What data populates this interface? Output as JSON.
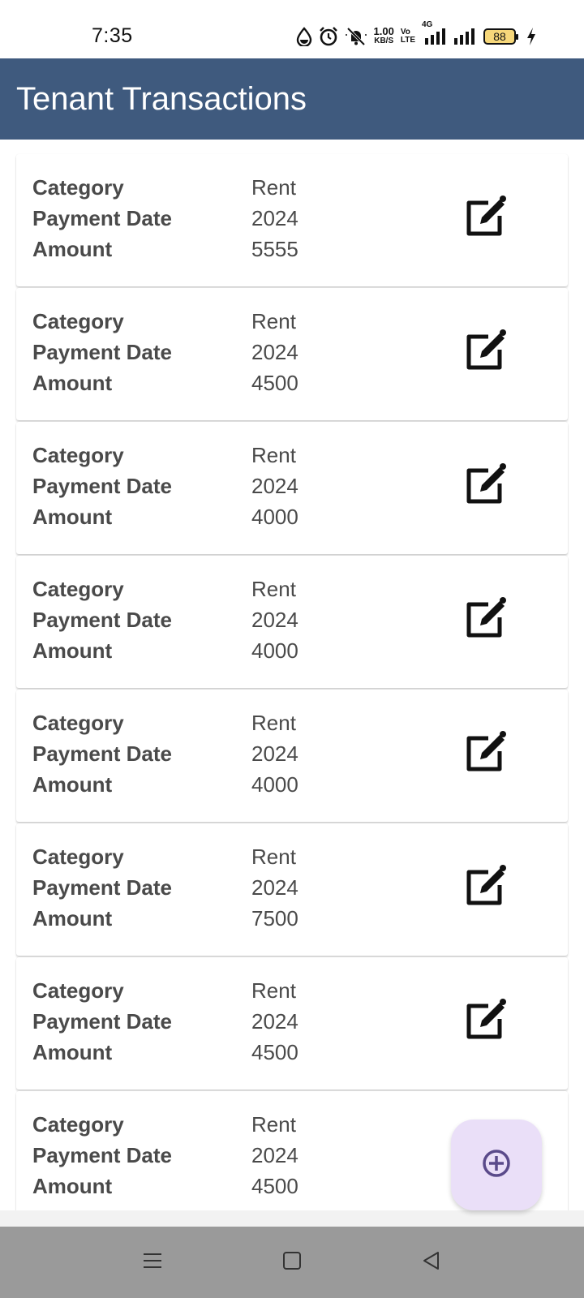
{
  "status_bar": {
    "time": "7:35",
    "net_speed_value": "1.00",
    "net_speed_unit": "KB/S",
    "volte_top": "Vo",
    "volte_bottom": "LTE",
    "network_type": "4G",
    "battery_level": "88",
    "icons": [
      "water-drop-icon",
      "alarm-icon",
      "silent-bell-icon",
      "signal-icon",
      "signal-icon",
      "battery-icon",
      "charging-icon"
    ]
  },
  "app_bar": {
    "title": "Tenant Transactions",
    "background_color": "#3f5a7e"
  },
  "transactions": [
    {
      "category_label": "Category",
      "payment_date_label": "Payment Date",
      "amount_label": "Amount",
      "category": "Rent",
      "payment_date": "2024",
      "amount": "5555"
    },
    {
      "category_label": "Category",
      "payment_date_label": "Payment Date",
      "amount_label": "Amount",
      "category": "Rent",
      "payment_date": "2024",
      "amount": "4500"
    },
    {
      "category_label": "Category",
      "payment_date_label": "Payment Date",
      "amount_label": "Amount",
      "category": "Rent",
      "payment_date": "2024",
      "amount": "4000"
    },
    {
      "category_label": "Category",
      "payment_date_label": "Payment Date",
      "amount_label": "Amount",
      "category": "Rent",
      "payment_date": "2024",
      "amount": "4000"
    },
    {
      "category_label": "Category",
      "payment_date_label": "Payment Date",
      "amount_label": "Amount",
      "category": "Rent",
      "payment_date": "2024",
      "amount": "4000"
    },
    {
      "category_label": "Category",
      "payment_date_label": "Payment Date",
      "amount_label": "Amount",
      "category": "Rent",
      "payment_date": "2024",
      "amount": "7500"
    },
    {
      "category_label": "Category",
      "payment_date_label": "Payment Date",
      "amount_label": "Amount",
      "category": "Rent",
      "payment_date": "2024",
      "amount": "4500"
    },
    {
      "category_label": "Category",
      "payment_date_label": "Payment Date",
      "amount_label": "Amount",
      "category": "Rent",
      "payment_date": "2024",
      "amount": "4500"
    }
  ],
  "row_icon": "edit-icon",
  "fab": {
    "icon": "add-circle-icon",
    "background_color": "#eadff8"
  },
  "nav_bar": {
    "icons": [
      "menu-icon",
      "home-square-icon",
      "back-triangle-icon"
    ]
  }
}
